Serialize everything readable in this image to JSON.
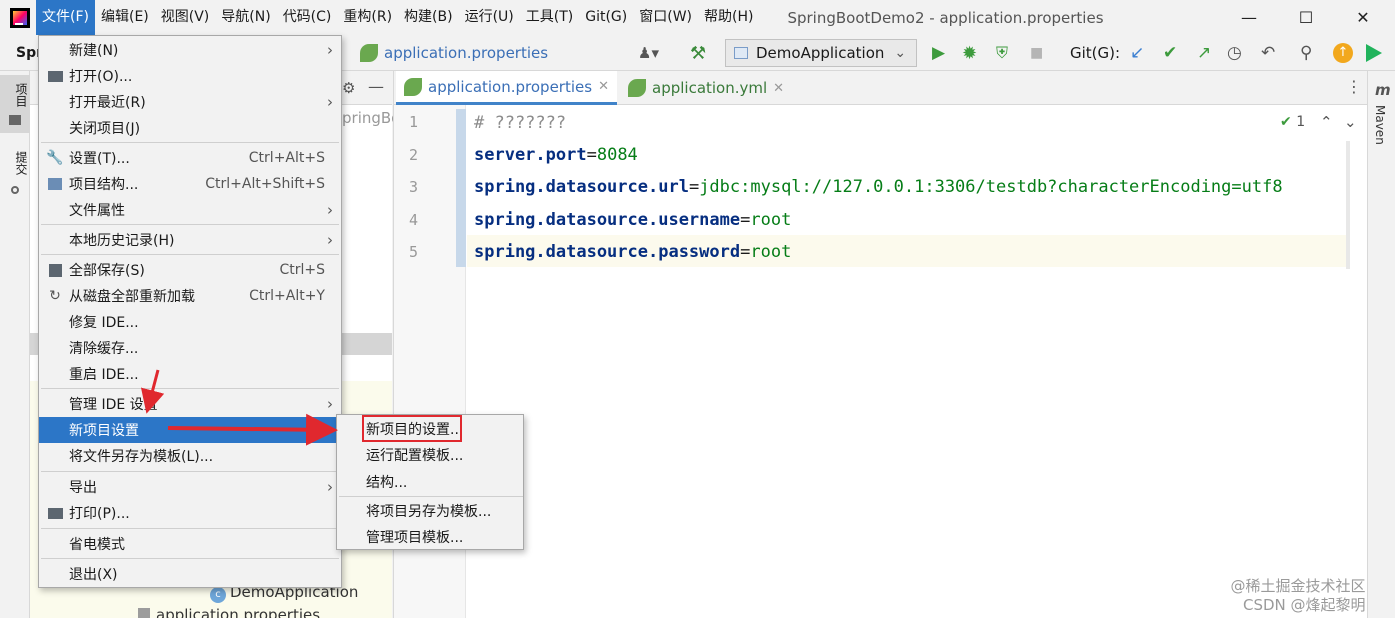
{
  "menubar": {
    "items": [
      {
        "label": "文件(F)",
        "active": true
      },
      {
        "label": "编辑(E)"
      },
      {
        "label": "视图(V)"
      },
      {
        "label": "导航(N)"
      },
      {
        "label": "代码(C)"
      },
      {
        "label": "重构(R)"
      },
      {
        "label": "构建(B)"
      },
      {
        "label": "运行(U)"
      },
      {
        "label": "工具(T)"
      },
      {
        "label": "Git(G)"
      },
      {
        "label": "窗口(W)"
      },
      {
        "label": "帮助(H)"
      }
    ],
    "window_title": "SpringBootDemo2 - application.properties",
    "minimize": "—",
    "maximize": "☐",
    "close": "✕"
  },
  "toolbar": {
    "project_short": "Spr",
    "breadcrumb_file": "application.properties",
    "run_config": "DemoApplication",
    "git_label": "Git(G):"
  },
  "left_strip": {
    "project_tab": "项目",
    "commit_tab": "提交"
  },
  "project_panel": {
    "partial_path": "pringBo",
    "tree_class": "DemoApplication",
    "tree_file": "application.properties"
  },
  "editor": {
    "tabs": [
      {
        "label": "application.properties",
        "active": true
      },
      {
        "label": "application.yml",
        "active": false
      }
    ],
    "inspection_count": "1",
    "lines": [
      {
        "num": "1",
        "comment": "# ???????"
      },
      {
        "num": "2",
        "key": "server.port",
        "value": "8084"
      },
      {
        "num": "3",
        "key": "spring.datasource.url",
        "value": "jdbc:mysql://127.0.0.1:3306/testdb?characterEncoding=utf8"
      },
      {
        "num": "4",
        "key": "spring.datasource.username",
        "value": "root"
      },
      {
        "num": "5",
        "key": "spring.datasource.password",
        "value": "root"
      }
    ]
  },
  "right_strip": {
    "maven_label": "Maven"
  },
  "file_menu": {
    "items": [
      {
        "label": "新建(N)",
        "submenu": true
      },
      {
        "label": "打开(O)..."
      },
      {
        "label": "打开最近(R)",
        "submenu": true
      },
      {
        "label": "关闭项目(J)"
      },
      {
        "label": "设置(T)...",
        "shortcut": "Ctrl+Alt+S"
      },
      {
        "label": "项目结构...",
        "shortcut": "Ctrl+Alt+Shift+S"
      },
      {
        "label": "文件属性",
        "submenu": true
      },
      {
        "label": "本地历史记录(H)",
        "submenu": true
      },
      {
        "label": "全部保存(S)",
        "shortcut": "Ctrl+S"
      },
      {
        "label": "从磁盘全部重新加载",
        "shortcut": "Ctrl+Alt+Y"
      },
      {
        "label": "修复 IDE..."
      },
      {
        "label": "清除缓存..."
      },
      {
        "label": "重启 IDE..."
      },
      {
        "label": "管理 IDE 设置",
        "submenu": true
      },
      {
        "label": "新项目设置",
        "submenu": true,
        "highlighted": true
      },
      {
        "label": "将文件另存为模板(L)..."
      },
      {
        "label": "导出",
        "submenu": true
      },
      {
        "label": "打印(P)..."
      },
      {
        "label": "省电模式"
      },
      {
        "label": "退出(X)"
      }
    ]
  },
  "sub_menu": {
    "items": [
      {
        "label": "新项目的设置..."
      },
      {
        "label": "运行配置模板..."
      },
      {
        "label": "结构..."
      },
      {
        "label": "将项目另存为模板..."
      },
      {
        "label": "管理项目模板..."
      }
    ]
  },
  "watermark": {
    "line1": "@稀土掘金技术社区",
    "line2": "CSDN @烽起黎明"
  },
  "colors": {
    "menu_highlight": "#2c76c7",
    "annotation_red": "#e0282e",
    "code_key": "#062e80",
    "code_value": "#067d17"
  }
}
